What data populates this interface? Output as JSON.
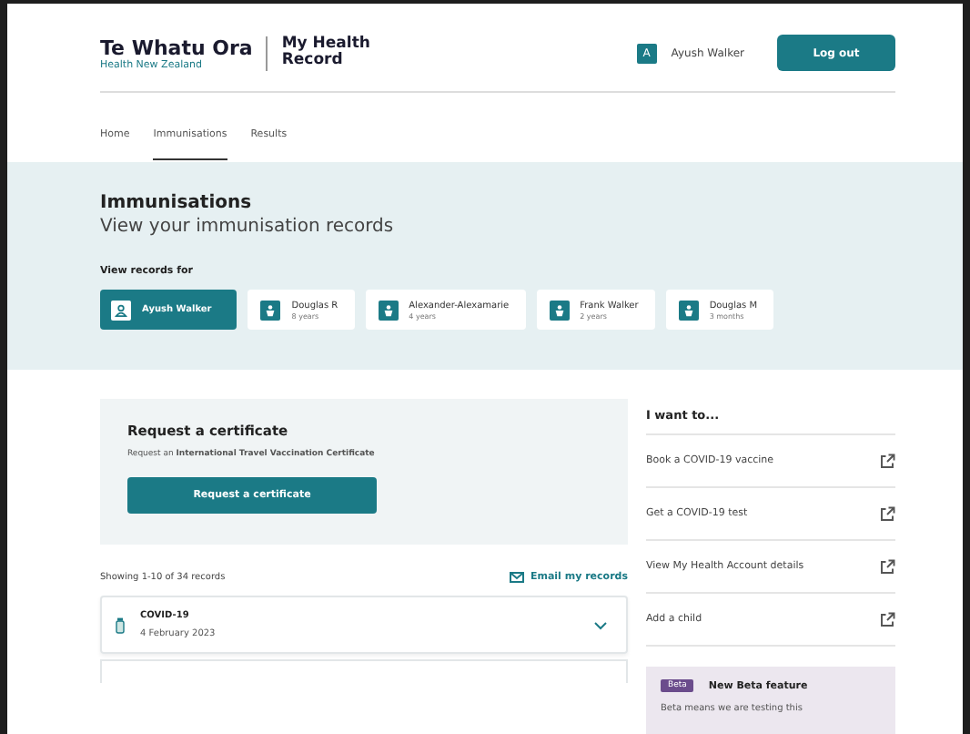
{
  "header": {
    "brand": "Te Whatu Ora",
    "brand_sub": "Health New Zealand",
    "product": "My Health Record",
    "user": "Ayush Walker",
    "user_initial": "A",
    "logout": "Log out"
  },
  "tabs": [
    {
      "label": "Home",
      "selected": false
    },
    {
      "label": "Immunisations",
      "selected": true
    },
    {
      "label": "Results",
      "selected": false
    }
  ],
  "intro": {
    "title": "Immunisations",
    "subtitle": "View your immunisation records",
    "records_for": "View records for"
  },
  "people": [
    {
      "kind": "adult",
      "name": "Ayush Walker",
      "selected": true
    },
    {
      "kind": "child",
      "name": "Douglas R",
      "age": "8 years",
      "selected": false
    },
    {
      "kind": "child",
      "name": "Alexander-Alexamarie",
      "age": "4 years",
      "selected": false
    },
    {
      "kind": "child",
      "name": "Frank Walker",
      "age": "2 years",
      "selected": false
    },
    {
      "kind": "child",
      "name": "Douglas M",
      "age": "3 months",
      "selected": false
    }
  ],
  "certificate": {
    "title": "Request a certificate",
    "text": "Request an **International Travel Vaccination Certificate**",
    "button": "Request a certificate"
  },
  "records": {
    "summary": "Showing 1-10 of 34 records",
    "email": "Email my records",
    "items": [
      {
        "name": "COVID-19",
        "date": "4 February 2023",
        "expanded": false
      }
    ]
  },
  "actions": {
    "title": "I want to...",
    "items": [
      "Book a COVID-19 vaccine",
      "Get a COVID-19 test",
      "View My Health Account details",
      "Add a child"
    ]
  },
  "beta": {
    "badge": "Beta",
    "title": "New Beta feature",
    "text": "Beta means we are testing this"
  }
}
